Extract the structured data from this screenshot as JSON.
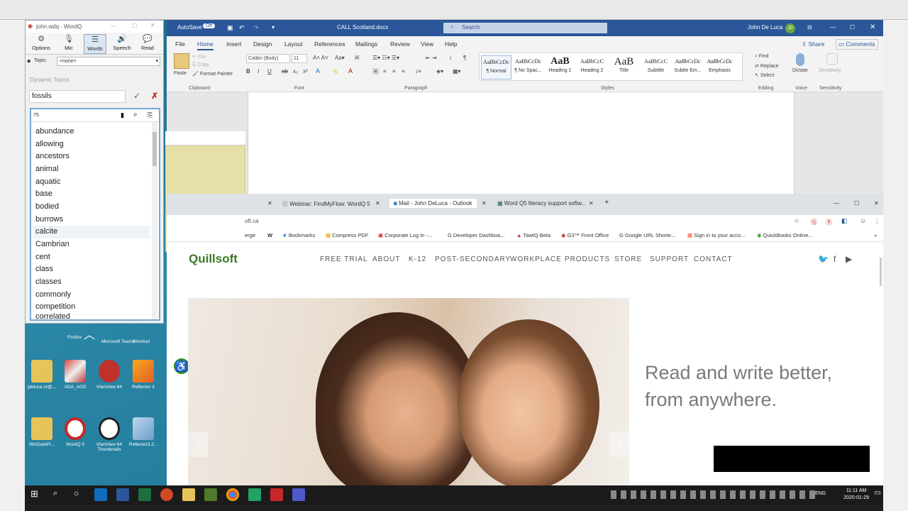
{
  "word": {
    "autosave_label": "AutoSave",
    "autosave_state": "Off",
    "doc_title": "CALL Scotland.docx",
    "search_placeholder": "Search",
    "user_name": "John De Luca",
    "user_initials": "JD",
    "tabs": [
      "File",
      "Home",
      "Insert",
      "Design",
      "Layout",
      "References",
      "Mailings",
      "Review",
      "View",
      "Help"
    ],
    "share_label": "Share",
    "comments_label": "Comments",
    "clipboard": {
      "paste": "Paste",
      "cut": "Cut",
      "copy": "Copy",
      "format_painter": "Format Painter",
      "group": "Clipboard"
    },
    "font": {
      "name": "Calibri (Body)",
      "size": "11",
      "group": "Font"
    },
    "paragraph_group": "Paragraph",
    "styles": [
      {
        "sample": "AaBbCcDc",
        "name": "¶ Normal"
      },
      {
        "sample": "AaBbCcDc",
        "name": "¶ No Spac..."
      },
      {
        "sample": "AaB",
        "name": "Heading 1"
      },
      {
        "sample": "AaBbCcC",
        "name": "Heading 2"
      },
      {
        "sample": "AaB",
        "name": "Title"
      },
      {
        "sample": "AaBbCcC",
        "name": "Subtitle"
      },
      {
        "sample": "AaBbCcDc",
        "name": "Subtle Em..."
      },
      {
        "sample": "AaBbCcDc",
        "name": "Emphasis"
      }
    ],
    "styles_group": "Styles",
    "editing": {
      "find": "Find",
      "replace": "Replace",
      "select": "Select",
      "group": "Editing"
    },
    "voice": {
      "dictate": "Dictate",
      "group": "Voice"
    },
    "sensitivity": {
      "label": "Sensitivity",
      "group": "Sensitivity"
    }
  },
  "wordq": {
    "title": "john.wdq - WordQ",
    "toolbar": [
      "Options",
      "Mic",
      "Words",
      "Speech",
      "Read"
    ],
    "topic_label": "Topic:",
    "topic_value": "<none>",
    "dynamic_topics": "Dynamic Topics",
    "input_value": "fossils",
    "search_count": "75",
    "words": [
      "abundance",
      "allowing",
      "ancestors",
      "animal",
      "aquatic",
      "base",
      "bodied",
      "burrows",
      "calcite",
      "Cambrian",
      "cent",
      "class",
      "classes",
      "commonly",
      "competition",
      "correlated"
    ]
  },
  "desktop_icons": [
    {
      "label": "jdeluca.vr@..."
    },
    {
      "label": "XDA_AOS"
    },
    {
      "label": "IrfanView 64"
    },
    {
      "label": "Reflector 3"
    },
    {
      "label": "WinDatePi..."
    },
    {
      "label": "WordQ 5"
    },
    {
      "label": "IrfanView 64 Thumbnails"
    },
    {
      "label": "Reflector3.2..."
    }
  ],
  "desktop_top_labels": [
    "Firefox",
    "Microsoft Teams",
    "Shortcut"
  ],
  "browser": {
    "tabs": [
      {
        "title": "Webinar: FindMyFlow: WordQ 5"
      },
      {
        "title": "Mail - John DeLuca - Outlook"
      },
      {
        "title": "Word Q5 literacy support softw..."
      }
    ],
    "address": "oft.ca",
    "bookmarks": [
      "erge",
      "Bookmarks",
      "Compress PDF",
      "Corporate Log In -...",
      "Developer Dashboa...",
      "TawtQ Beta",
      "G3™ Front Office",
      "Google URL Shorte...",
      "Sign in to your acco...",
      "QuickBooks Online..."
    ],
    "site": {
      "logo": "Quillsoft",
      "nav": [
        "FREE TRIAL",
        "ABOUT",
        "K-12",
        "POST-SECONDARY",
        "WORKPLACE",
        "PRODUCTS",
        "STORE",
        "SUPPORT",
        "CONTACT"
      ],
      "hero_line1": "Read and write better,",
      "hero_line2": "from anywhere."
    }
  },
  "taskbar": {
    "lang": "ENG",
    "time": "11:11 AM",
    "date": "2020-01-29"
  }
}
